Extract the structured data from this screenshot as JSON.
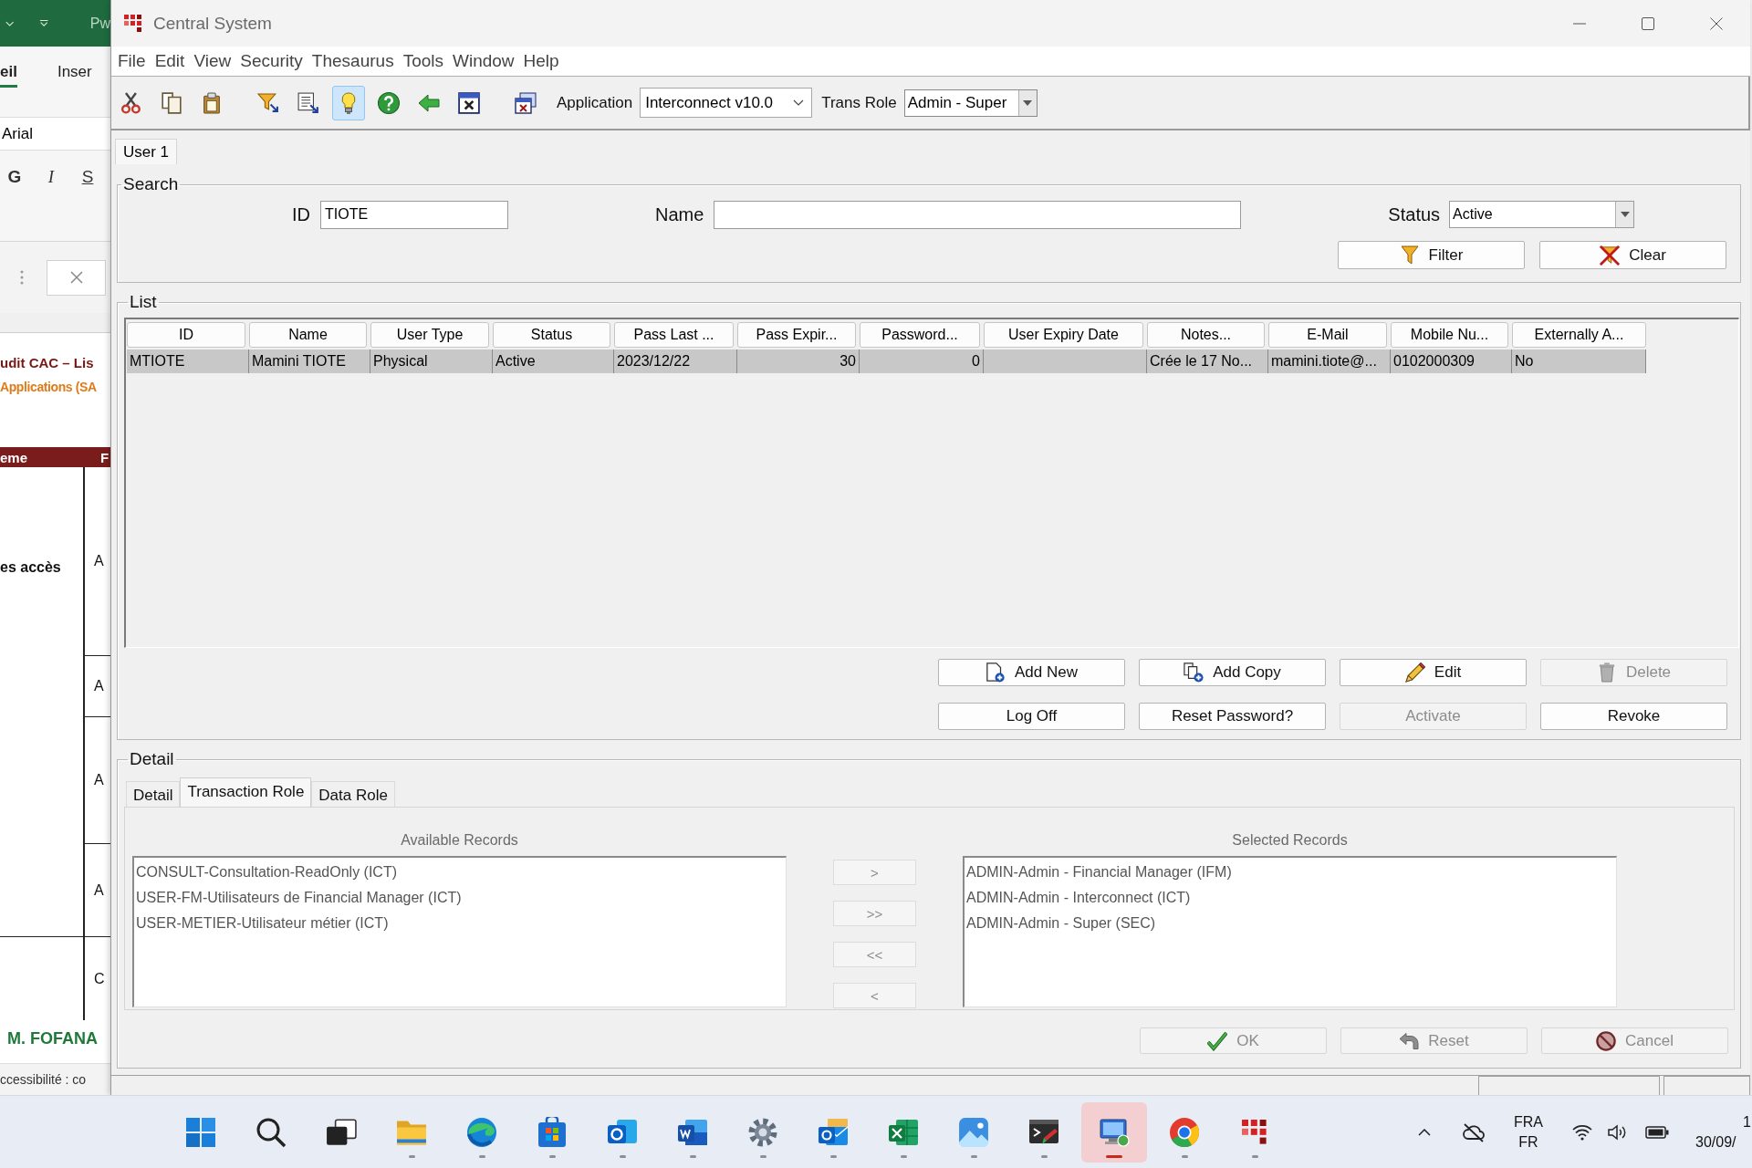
{
  "background_window": {
    "title": "Pw",
    "ribbon_tabs": [
      {
        "label": "eil",
        "selected": true
      },
      {
        "label": "Inser",
        "selected": false
      }
    ],
    "font_field": "Arial",
    "format_buttons": [
      {
        "label": "G",
        "kind": "bold"
      },
      {
        "label": "I",
        "kind": "italic"
      },
      {
        "label": "S",
        "kind": "underline"
      }
    ],
    "sheet": {
      "title": "udit CAC – Lis",
      "subtitle": "Applications (SA",
      "header_cells": [
        "eme",
        "F"
      ],
      "groups": [
        {
          "label": "es accès",
          "cells": [
            "A",
            "A",
            "A",
            "A"
          ]
        },
        {
          "cells": [
            "C"
          ]
        }
      ],
      "signature": "M. FOFANA"
    },
    "status_text": "ccessibilité : co"
  },
  "window": {
    "title": "Central System",
    "menu": [
      "File",
      "Edit",
      "View",
      "Security",
      "Thesaurus",
      "Tools",
      "Window",
      "Help"
    ],
    "toolbar": {
      "buttons": [
        {
          "kind": "cut",
          "pressed": false
        },
        {
          "kind": "copy",
          "pressed": false
        },
        {
          "kind": "paste",
          "pressed": false
        },
        {
          "kind": "filter",
          "pressed": false
        },
        {
          "kind": "select",
          "pressed": false
        },
        {
          "kind": "hint",
          "pressed": true
        },
        {
          "kind": "help",
          "pressed": false
        },
        {
          "kind": "back",
          "pressed": false
        },
        {
          "kind": "close",
          "pressed": false
        },
        {
          "kind": "windows",
          "pressed": false
        }
      ],
      "application": {
        "label": "Application",
        "value": "Interconnect v10.0"
      },
      "trans_role": {
        "label": "Trans Role",
        "value": "Admin - Super"
      }
    },
    "document_tabs": [
      {
        "label": "User 1",
        "selected": true
      }
    ],
    "search": {
      "legend": "Search",
      "fields": [
        {
          "kind": "text",
          "label": "ID",
          "value": "TIOTE"
        },
        {
          "kind": "text",
          "label": "Name"
        },
        {
          "kind": "select",
          "label": "Status",
          "value": "Active"
        }
      ],
      "buttons": [
        {
          "label": "Filter",
          "kind": "filter",
          "disabled": false
        },
        {
          "label": "Clear",
          "kind": "clear",
          "disabled": false
        }
      ]
    },
    "list": {
      "legend": "List",
      "columns": [
        {
          "label": "ID",
          "kind": "text"
        },
        {
          "label": "Name",
          "kind": "text"
        },
        {
          "label": "User Type",
          "kind": "text"
        },
        {
          "label": "Status",
          "kind": "text"
        },
        {
          "label": "Pass Last ...",
          "kind": "text"
        },
        {
          "label": "Pass Expir...",
          "kind": "number"
        },
        {
          "label": "Password...",
          "kind": "number"
        },
        {
          "label": "User Expiry Date",
          "kind": "text"
        },
        {
          "label": "Notes...",
          "kind": "text"
        },
        {
          "label": "E-Mail",
          "kind": "text"
        },
        {
          "label": "Mobile Nu...",
          "kind": "text"
        },
        {
          "label": "Externally A...",
          "kind": "text"
        }
      ],
      "rows": [
        {
          "selected": true,
          "cells": [
            "MTIOTE",
            "Mamini TIOTE",
            "Physical",
            "Active",
            "2023/12/22",
            "30",
            "0",
            null,
            "Crée le 17 No...",
            "mamini.tiote@...",
            "0102000309",
            "No"
          ]
        }
      ],
      "buttons": [
        {
          "label": "Add New",
          "kind": "add_new",
          "disabled": false
        },
        {
          "label": "Add Copy",
          "kind": "add_copy",
          "disabled": false
        },
        {
          "label": "Edit",
          "kind": "edit",
          "disabled": false
        },
        {
          "label": "Delete",
          "kind": "delete",
          "disabled": true
        },
        {
          "label": "Log Off",
          "kind": "plain",
          "disabled": false
        },
        {
          "label": "Reset Password?",
          "kind": "plain",
          "disabled": false
        },
        {
          "label": "Activate",
          "kind": "plain",
          "disabled": true
        },
        {
          "label": "Revoke",
          "kind": "plain",
          "disabled": false
        }
      ]
    },
    "detail": {
      "legend": "Detail",
      "tabs": [
        {
          "label": "Detail",
          "selected": false
        },
        {
          "label": "Transaction Role",
          "selected": true
        },
        {
          "label": "Data Role",
          "selected": false
        }
      ],
      "available": {
        "label": "Available Records",
        "items": [
          "CONSULT-Consultation-ReadOnly (ICT)",
          "USER-FM-Utilisateurs de Financial Manager (ICT)",
          "USER-METIER-Utilisateur métier (ICT)"
        ]
      },
      "transfer_buttons": [
        {
          "label": ">",
          "disabled": true
        },
        {
          "label": ">>",
          "disabled": true
        },
        {
          "label": "<<",
          "disabled": true
        },
        {
          "label": "<",
          "disabled": true
        }
      ],
      "selected": {
        "label": "Selected Records",
        "items": [
          "ADMIN-Admin - Financial Manager (IFM)",
          "ADMIN-Admin - Interconnect (ICT)",
          "ADMIN-Admin - Super (SEC)"
        ]
      },
      "buttons": [
        {
          "label": "OK",
          "kind": "ok",
          "disabled": true
        },
        {
          "label": "Reset",
          "kind": "reset",
          "disabled": true
        },
        {
          "label": "Cancel",
          "kind": "cancel",
          "disabled": true
        }
      ]
    }
  },
  "taskbar": {
    "apps": [
      {
        "kind": "start",
        "running": false,
        "active": false
      },
      {
        "kind": "search",
        "running": false,
        "active": false
      },
      {
        "kind": "task_view",
        "running": false,
        "active": false
      },
      {
        "kind": "files",
        "running": true,
        "active": false
      },
      {
        "kind": "browser",
        "running": true,
        "active": false
      },
      {
        "kind": "store",
        "running": true,
        "active": false
      },
      {
        "kind": "mail_new",
        "running": true,
        "active": false
      },
      {
        "kind": "word",
        "running": true,
        "active": false
      },
      {
        "kind": "settings",
        "running": true,
        "active": false
      },
      {
        "kind": "mail",
        "running": true,
        "active": false
      },
      {
        "kind": "sheet",
        "running": true,
        "active": false
      },
      {
        "kind": "photos",
        "running": true,
        "active": false
      },
      {
        "kind": "tool",
        "running": true,
        "active": false
      },
      {
        "kind": "remote",
        "running": true,
        "active": true
      },
      {
        "kind": "chrome",
        "running": true,
        "active": false
      },
      {
        "kind": "grid",
        "running": true,
        "active": false
      }
    ],
    "tray": [
      {
        "kind": "chevron"
      },
      {
        "kind": "cloud_off"
      },
      {
        "kind": "language",
        "label": "FRA",
        "sublabel": "FR"
      },
      {
        "kind": "wifi"
      },
      {
        "kind": "volume"
      },
      {
        "kind": "battery"
      },
      {
        "kind": "clock",
        "label": "1",
        "sublabel": "30/09/"
      }
    ]
  }
}
